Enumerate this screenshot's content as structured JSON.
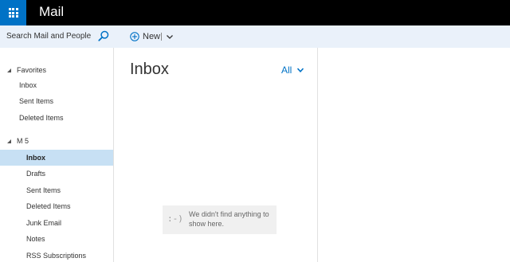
{
  "header": {
    "app_title": "Mail",
    "launcher_icon": "app-launcher-waffle-icon"
  },
  "commandbar": {
    "search_text": "Search Mail and People",
    "search_icon": "search-icon",
    "new_label": "New",
    "new_icon": "plus-circle-icon",
    "new_dropdown_icon": "chevron-down-icon"
  },
  "nav": {
    "favorites": {
      "label": "Favorites",
      "items": [
        {
          "label": "Inbox"
        },
        {
          "label": "Sent Items"
        },
        {
          "label": "Deleted Items"
        }
      ]
    },
    "account": {
      "label": "M 5",
      "items": [
        {
          "label": "Inbox",
          "selected": true
        },
        {
          "label": "Drafts"
        },
        {
          "label": "Sent Items"
        },
        {
          "label": "Deleted Items"
        },
        {
          "label": "Junk Email"
        },
        {
          "label": "Notes"
        },
        {
          "label": "RSS Subscriptions"
        }
      ]
    }
  },
  "list": {
    "folder_title": "Inbox",
    "filter_label": "All",
    "empty_face": ":-)",
    "empty_message": "We didn't find anything to show here."
  },
  "colors": {
    "accent": "#0072c6",
    "header_bg": "#000000",
    "command_bg": "#eaf1fa",
    "selected_bg": "#c7e0f4"
  }
}
